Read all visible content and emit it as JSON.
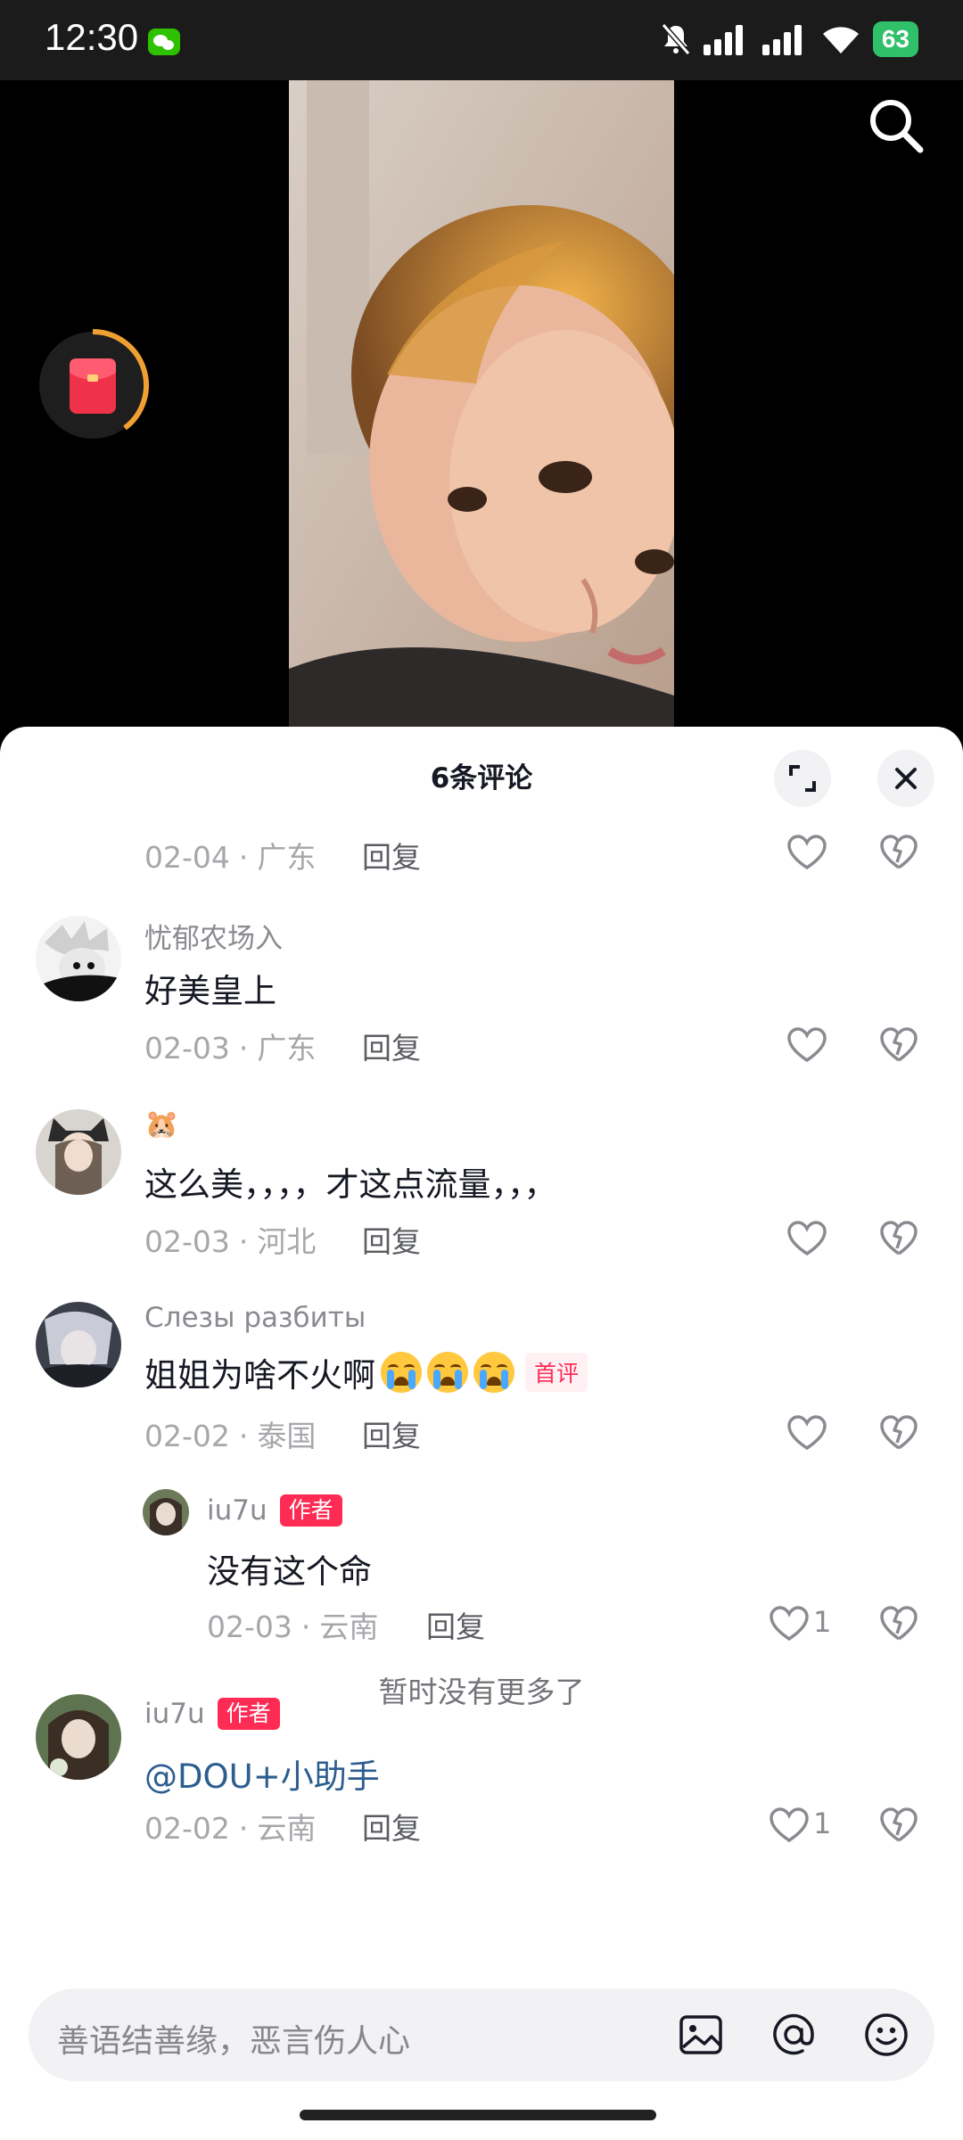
{
  "status_bar": {
    "time": "12:30",
    "battery": "63"
  },
  "sheet": {
    "title": "6条评论"
  },
  "comments": [
    {
      "meta_date": "02-04",
      "meta_region": "广东",
      "reply_label": "回复"
    },
    {
      "username": "忧郁农场入",
      "text": "好美皇上",
      "meta_date": "02-03",
      "meta_region": "广东",
      "reply_label": "回复"
    },
    {
      "username": "🐹",
      "text": "这么美，，，，才这点流量，，，",
      "meta_date": "02-03",
      "meta_region": "河北",
      "reply_label": "回复"
    },
    {
      "username": "Слезы разбиты",
      "text": "姐姐为啥不火啊",
      "tag": "首评",
      "meta_date": "02-02",
      "meta_region": "泰国",
      "reply_label": "回复"
    },
    {
      "username": "iu7u",
      "tag": "作者",
      "text": "没有这个命",
      "meta_date": "02-03",
      "meta_region": "云南",
      "reply_label": "回复",
      "likes": "1"
    },
    {
      "username": "iu7u",
      "tag": "作者",
      "text": "@DOU+小助手",
      "meta_date": "02-02",
      "meta_region": "云南",
      "reply_label": "回复",
      "likes": "1"
    }
  ],
  "footer": {
    "no_more": "暂时没有更多了",
    "input_placeholder": "善语结善缘，恶言伤人心"
  },
  "colors": {
    "accent": "#fe2c55",
    "mention": "#2c5d8f",
    "sheet_bg": "#ffffff"
  },
  "icons": [
    "wechat-icon",
    "mute-icon",
    "signal-icon",
    "wifi-icon",
    "search-icon",
    "red-packet-icon",
    "expand-icon",
    "close-icon",
    "heart-icon",
    "dislike-icon",
    "image-icon",
    "at-icon",
    "emoji-icon"
  ]
}
